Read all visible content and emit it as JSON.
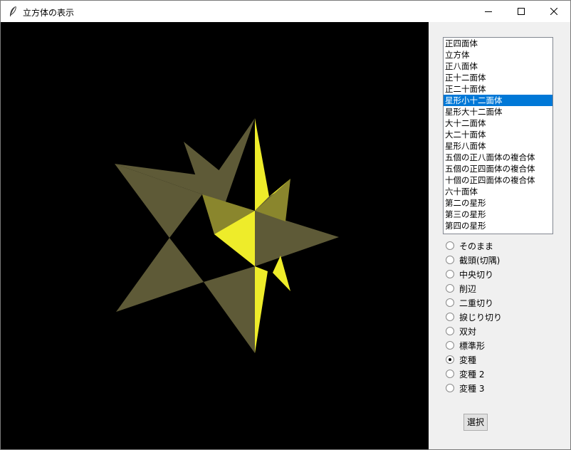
{
  "window": {
    "title": "立方体の表示"
  },
  "colors": {
    "face_dark": "#5e5a37",
    "face_mid": "#8a862d",
    "face_bright": "#eeec2a",
    "selection": "#0078d7"
  },
  "list": {
    "items": [
      {
        "label": "正四面体"
      },
      {
        "label": "立方体"
      },
      {
        "label": "正八面体"
      },
      {
        "label": "正十二面体"
      },
      {
        "label": "正二十面体"
      },
      {
        "label": "星形小十二面体"
      },
      {
        "label": "星形大十二面体"
      },
      {
        "label": "大十二面体"
      },
      {
        "label": "大二十面体"
      },
      {
        "label": "星形八面体"
      },
      {
        "label": "五個の正八面体の複合体"
      },
      {
        "label": "五個の正四面体の複合体"
      },
      {
        "label": "十個の正四面体の複合体"
      },
      {
        "label": "六十面体"
      },
      {
        "label": "第二の星形"
      },
      {
        "label": "第三の星形"
      },
      {
        "label": "第四の星形"
      }
    ],
    "selected": "星形小十二面体"
  },
  "radios": {
    "options": [
      {
        "label": "そのまま"
      },
      {
        "label": "截頭(切隅)"
      },
      {
        "label": "中央切り"
      },
      {
        "label": "削辺"
      },
      {
        "label": "二重切り"
      },
      {
        "label": "捩じり切り"
      },
      {
        "label": "双対"
      },
      {
        "label": "標準形"
      },
      {
        "label": "変種"
      },
      {
        "label": "変種 2"
      },
      {
        "label": "変種 3"
      }
    ],
    "selected": "変種"
  },
  "buttons": {
    "select_label": "選択"
  }
}
